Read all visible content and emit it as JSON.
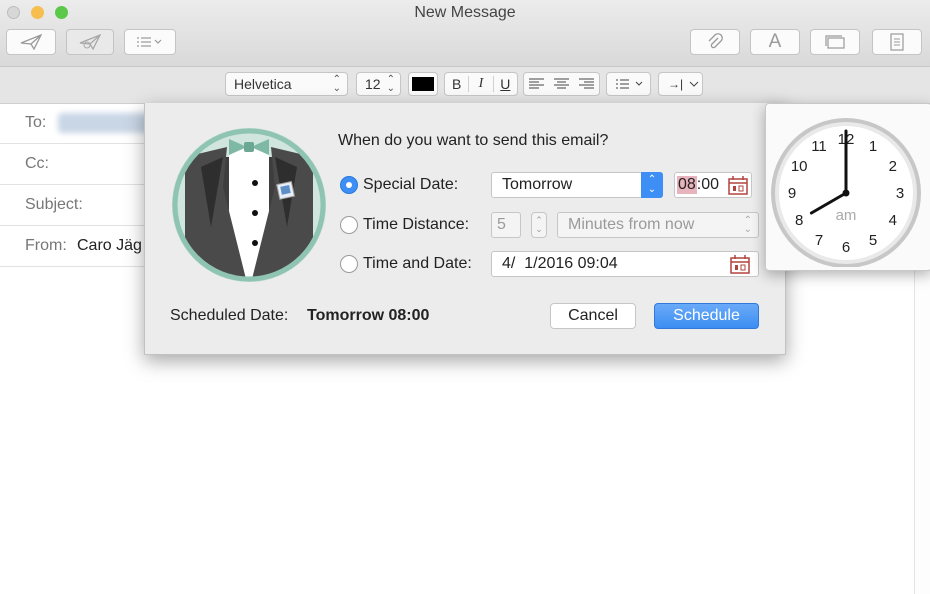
{
  "window": {
    "title": "New Message"
  },
  "toolbar": {
    "send_icon": "send-icon",
    "send_later_icon": "send-later-icon",
    "header_fields_icon": "list-options-icon",
    "attach_icon": "paperclip-icon",
    "format_label": "A",
    "photo_browser_icon": "photo-browser-icon",
    "stationery_icon": "stationery-icon"
  },
  "format_bar": {
    "font": "Helvetica",
    "size": "12",
    "text_color": "#000000",
    "bold": "B",
    "italic": "I",
    "underline": "U",
    "indent_symbol": "→|"
  },
  "headers": {
    "to_label": "To:",
    "cc_label": "Cc:",
    "subject_label": "Subject:",
    "from_label": "From:",
    "from_value": "Caro Jäg"
  },
  "dialog": {
    "question": "When do you want to send this email?",
    "special_date_label": "Special Date:",
    "special_date_value": "Tomorrow",
    "time_value": "08:00",
    "time_hour": "08",
    "time_minutes": ":00",
    "time_distance_label": "Time Distance:",
    "distance_value": "5",
    "distance_unit": "Minutes from now",
    "time_and_date_label": "Time and Date:",
    "date_value": "4/  1/2016 09:04",
    "scheduled_label": "Scheduled Date:",
    "scheduled_value": "Tomorrow 08:00",
    "cancel_label": "Cancel",
    "schedule_label": "Schedule",
    "selected_option": "special_date"
  },
  "clock": {
    "numbers": [
      "12",
      "1",
      "2",
      "3",
      "4",
      "5",
      "6",
      "7",
      "8",
      "9",
      "10",
      "11"
    ],
    "period": "am",
    "hour": 8,
    "minute": 0
  },
  "colors": {
    "accent": "#3d8ff5",
    "schedule_button": "#3c8ef3",
    "time_highlight": "#e7b3bd",
    "calendar_icon": "#b2443f"
  }
}
